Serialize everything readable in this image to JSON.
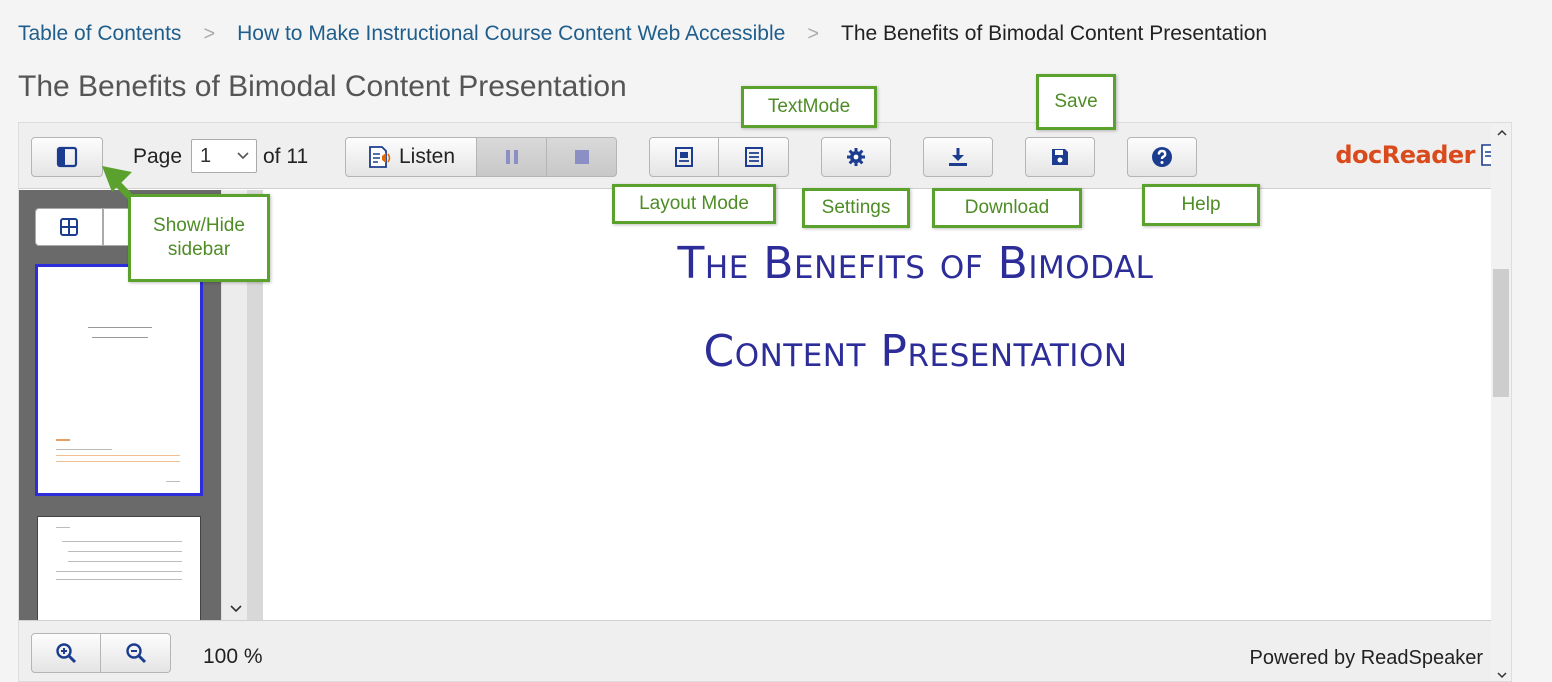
{
  "breadcrumb": {
    "items": [
      "Table of Contents",
      "How to Make Instructional Course Content Web Accessible"
    ],
    "current": "The Benefits of Bimodal Content Presentation"
  },
  "page": {
    "title": "The Benefits of Bimodal Content Presentation"
  },
  "toolbar": {
    "page_label": "Page",
    "page_value": "1",
    "of_label": "of 11",
    "listen_label": "Listen",
    "brand": "docReader"
  },
  "document": {
    "title_line1": "The Benefits of Bimodal",
    "title_line2": "Content Presentation"
  },
  "bottombar": {
    "zoom": "100 %",
    "powered_by": "Powered by ReadSpeaker"
  },
  "callouts": {
    "show_hide_sidebar": "Show/Hide sidebar",
    "textmode": "TextMode",
    "save": "Save",
    "layout_mode": "Layout Mode",
    "settings": "Settings",
    "download": "Download",
    "help": "Help"
  },
  "colors": {
    "link": "#1f5e8c",
    "doc_title": "#2d2d9a",
    "callout_green": "#5aa12e",
    "thumb_selected": "#2d2ddb",
    "brand": "#d94a1c"
  },
  "icons": [
    "sidebar-toggle-icon",
    "listen-speaker-icon",
    "pause-icon",
    "stop-icon",
    "layout-mode-icon",
    "text-mode-icon",
    "gear-icon",
    "download-icon",
    "save-disk-icon",
    "help-icon",
    "thumbnails-grid-icon",
    "zoom-in-icon",
    "zoom-out-icon"
  ]
}
